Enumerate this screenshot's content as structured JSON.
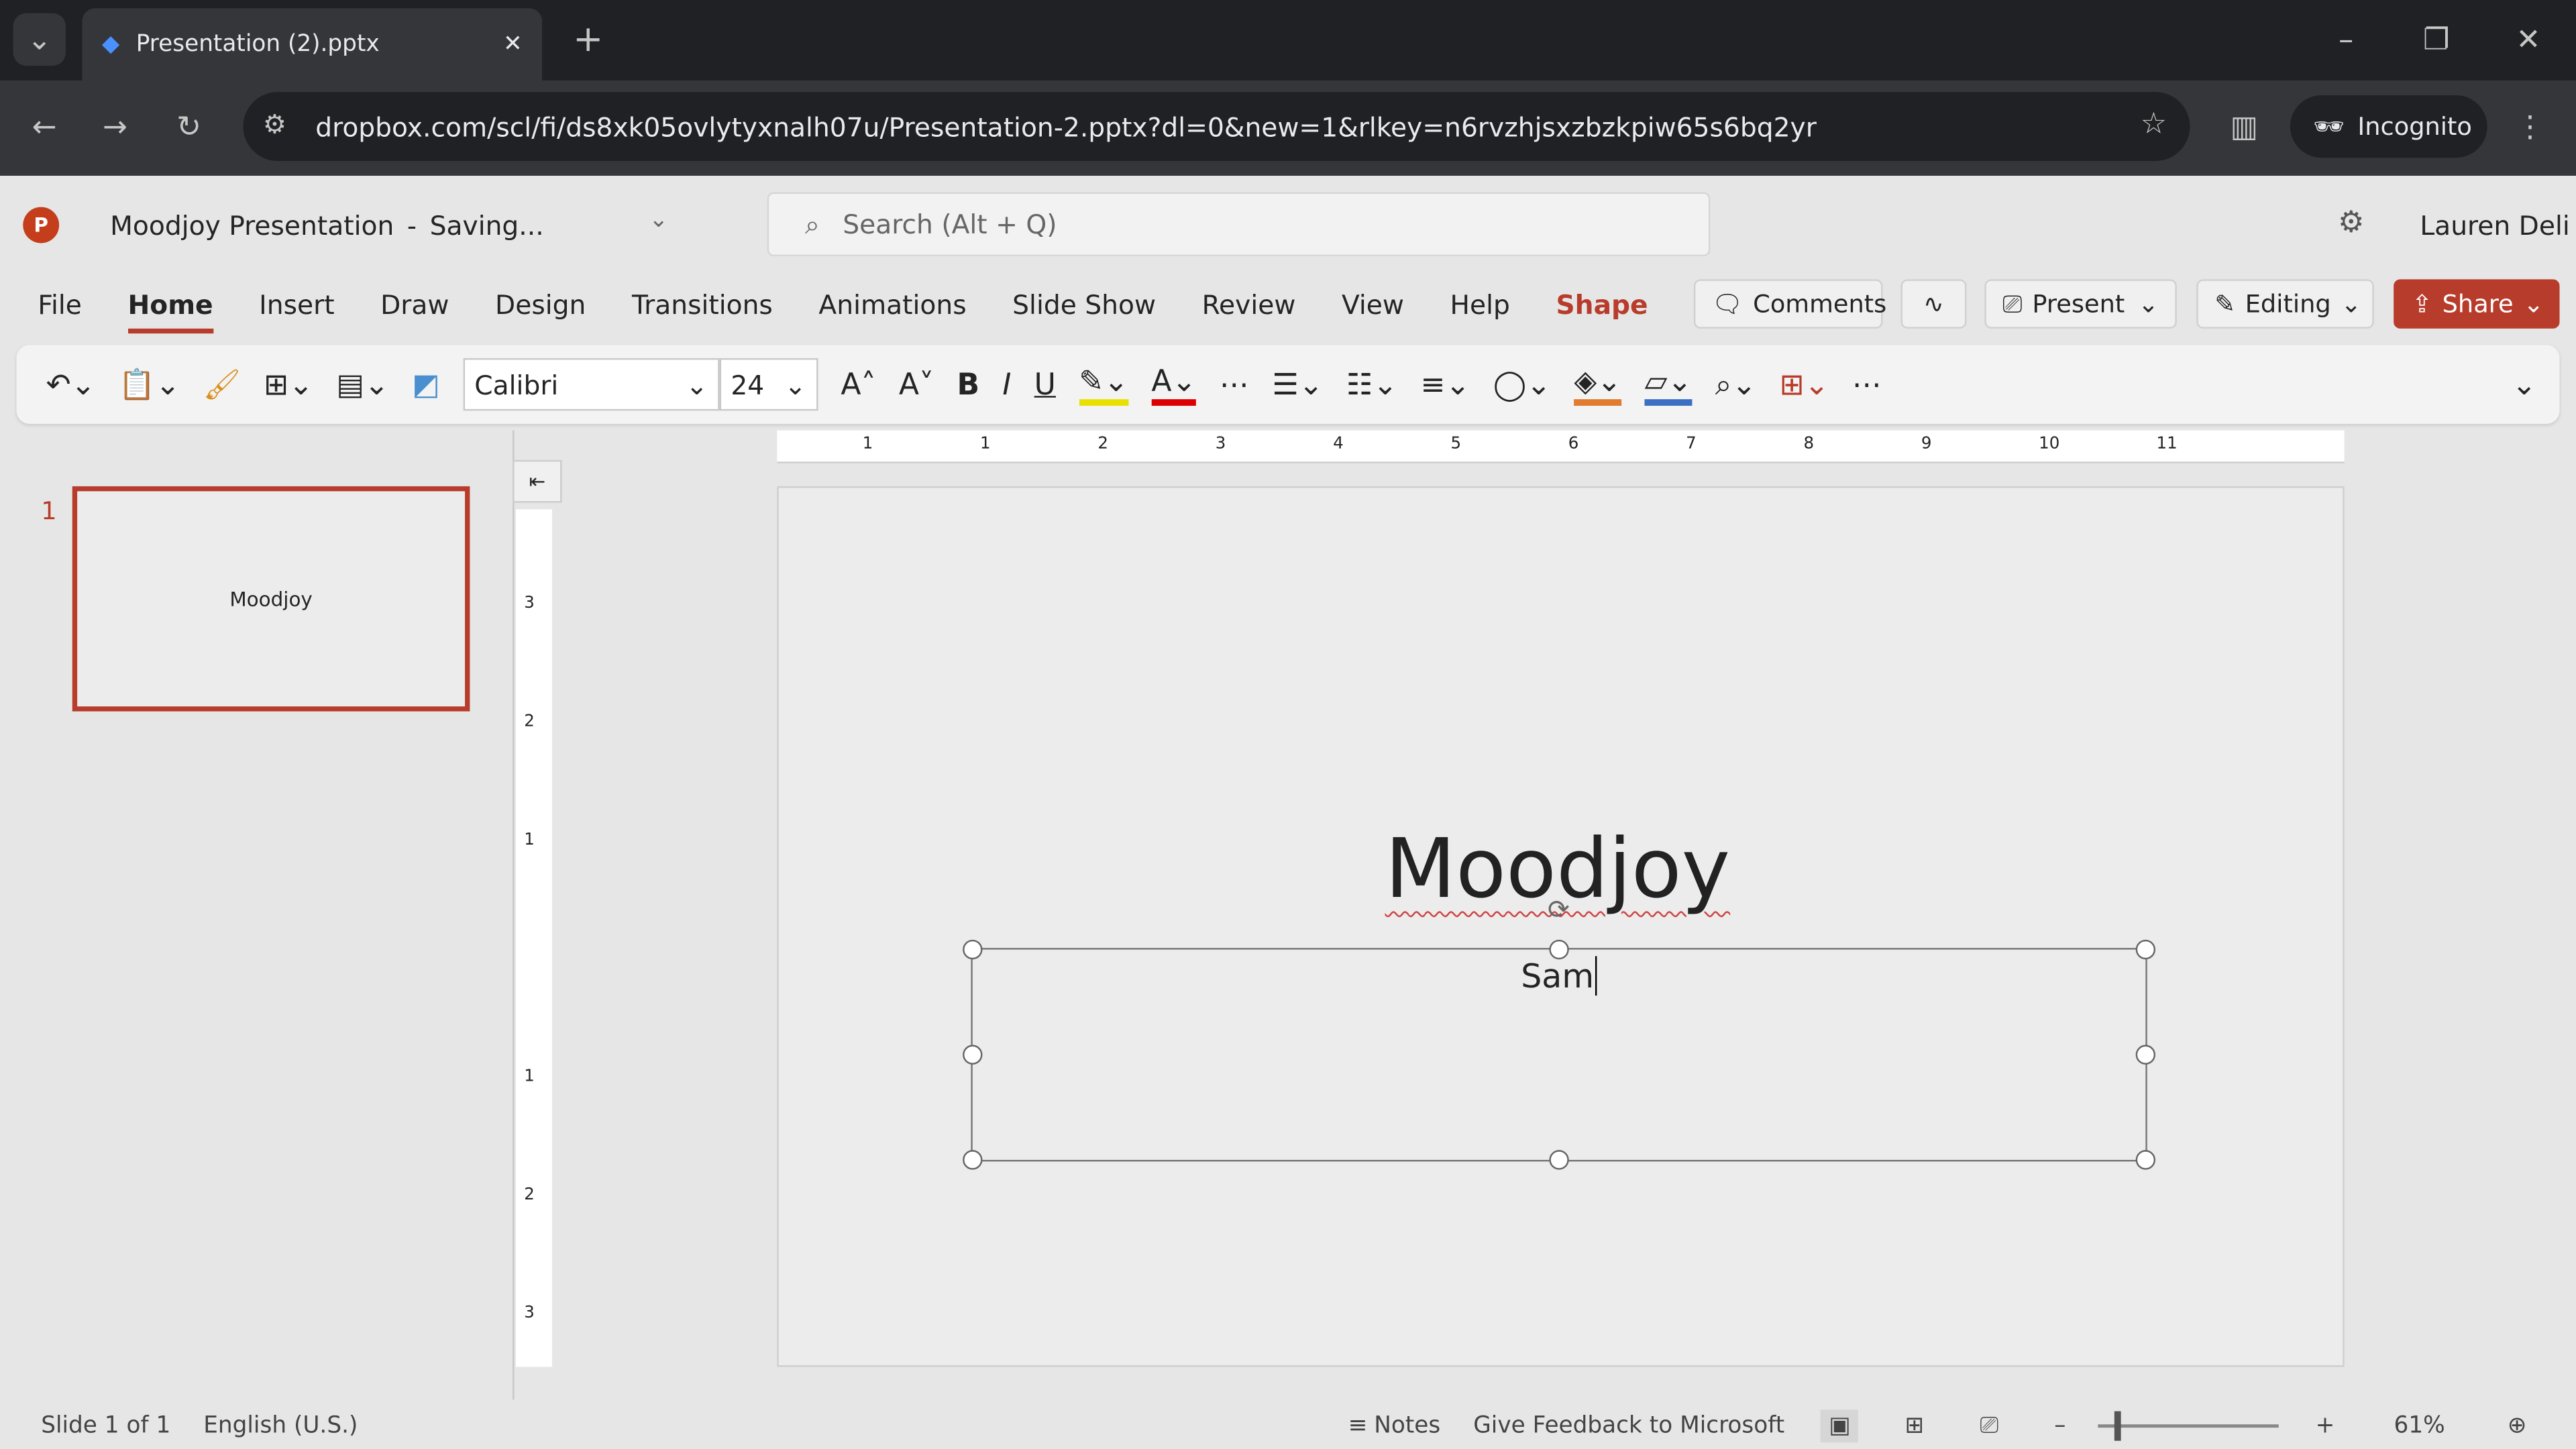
{
  "browser": {
    "tab_title": "Presentation (2).pptx",
    "url": "dropbox.com/scl/fi/ds8xk05ovlytyxnalh07u/Presentation-2.pptx?dl=0&new=1&rlkey=n6rvzhjsxzbzkpiw65s6bq2yr",
    "incognito_label": "Incognito"
  },
  "app": {
    "doc_title": "Moodjoy Presentation",
    "save_status": "Saving...",
    "search_placeholder": "Search (Alt + Q)",
    "user": "Lauren Deli",
    "brand_color": "#b83c2b"
  },
  "menu": [
    "File",
    "Home",
    "Insert",
    "Draw",
    "Design",
    "Transitions",
    "Animations",
    "Slide Show",
    "Review",
    "View",
    "Help",
    "Shape"
  ],
  "actions": {
    "comments": "Comments",
    "present": "Present",
    "editing": "Editing",
    "share": "Share"
  },
  "ribbon": {
    "font": "Calibri",
    "size": "24"
  },
  "ruler": {
    "h": [
      "1",
      "1",
      "2",
      "3",
      "4",
      "5",
      "6",
      "7",
      "8",
      "9",
      "10",
      "11"
    ],
    "v": [
      "3",
      "2",
      "1",
      "",
      "1",
      "2",
      "3"
    ]
  },
  "thumbs": [
    {
      "num": "1",
      "title": "Moodjoy"
    }
  ],
  "slide": {
    "title": "Moodjoy",
    "subtitle": "Sam"
  },
  "status": {
    "slide": "Slide 1 of 1",
    "lang": "English (U.S.)",
    "notes": "Notes",
    "feedback": "Give Feedback to Microsoft",
    "zoom": "61%"
  }
}
